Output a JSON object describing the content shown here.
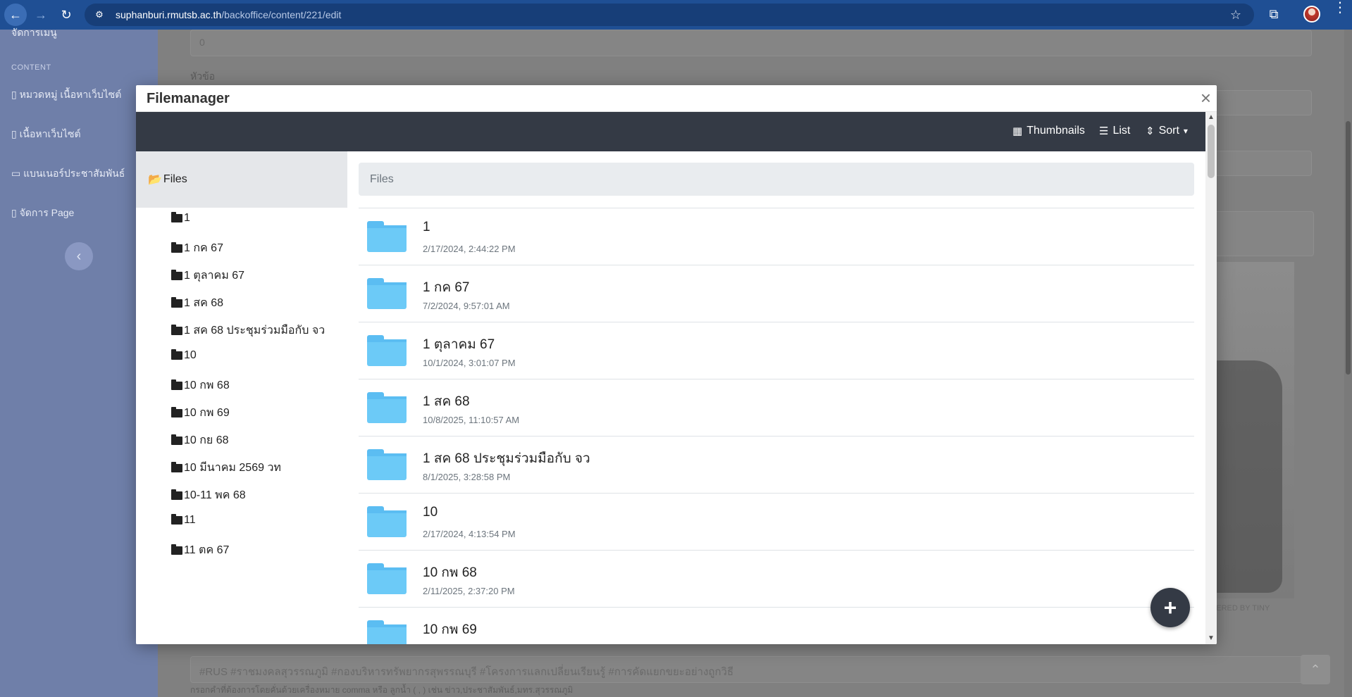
{
  "browser": {
    "url_host": "suphanburi.rmutsb.ac.th",
    "url_path": "/backoffice/content/221/edit",
    "back_icon": "←",
    "forward_icon": "→",
    "reload_icon": "↻",
    "site_icon": "⚙",
    "star_icon": "☆",
    "extensions_icon": "⧉",
    "menu_icon": "⋮"
  },
  "sidebar": {
    "top_item": "จัดการเมนู",
    "section_heading": "CONTENT",
    "items": [
      {
        "label": "หมวดหมู่ เนื้อหาเว็บไซต์"
      },
      {
        "label": "เนื้อหาเว็บไซต์"
      },
      {
        "label": "แบนเนอร์ประชาสัมพันธ์"
      },
      {
        "label": "จัดการ Page"
      }
    ],
    "collapse_icon": "‹"
  },
  "background_form": {
    "order_value": "0",
    "title_label": "หัวข้อ",
    "editor_powered": "POWERED BY TINY",
    "tags_value": "#RUS #ราชมงคลสุวรรณภูมิ #กองบริหารทรัพยากรสุพรรณบุรี #โครงการแลกเปลี่ยนเรียนรู้ #การคัดแยกขยะอย่างถูกวิธี",
    "tags_hint": "กรอกคำที่ต้องการโดยคั่นด้วยเครื่องหมาย comma หรือ ลูกน้ำ ( , ) เช่น ข่าว,ประชาสัมพันธ์,มทร.สุวรรณภูมิ",
    "scroll_top_icon": "⌃"
  },
  "modal": {
    "title": "Filemanager",
    "close_icon": "×",
    "toolbar": {
      "thumbnails_label": "Thumbnails",
      "list_label": "List",
      "sort_label": "Sort",
      "thumbnails_icon": "▦",
      "list_icon": "☰",
      "sort_icon": "⇕",
      "caret_icon": "▾"
    },
    "tree": {
      "root_label": "Files",
      "items": [
        {
          "label": "1"
        },
        {
          "label": "1 กค 67"
        },
        {
          "label": "1 ตุลาคม 67"
        },
        {
          "label": "1 สค 68"
        },
        {
          "label": "1 สค 68 ประชุมร่วมมือกับ จว"
        },
        {
          "label": "10"
        },
        {
          "label": "10 กพ 68"
        },
        {
          "label": "10 กพ 69"
        },
        {
          "label": "10 กย 68"
        },
        {
          "label": "10 มีนาคม 2569 วท"
        },
        {
          "label": "10-11 พค 68"
        },
        {
          "label": "11"
        },
        {
          "label": "11 ตค 67"
        }
      ]
    },
    "breadcrumb": "Files",
    "files": [
      {
        "name": "1",
        "date": "2/17/2024, 2:44:22 PM"
      },
      {
        "name": "1 กค 67",
        "date": "7/2/2024, 9:57:01 AM"
      },
      {
        "name": "1 ตุลาคม 67",
        "date": "10/1/2024, 3:01:07 PM"
      },
      {
        "name": "1 สค 68",
        "date": "10/8/2025, 11:10:57 AM"
      },
      {
        "name": "1 สค 68 ประชุมร่วมมือกับ จว",
        "date": "8/1/2025, 3:28:58 PM"
      },
      {
        "name": "10",
        "date": "2/17/2024, 4:13:54 PM"
      },
      {
        "name": "10 กพ 68",
        "date": "2/11/2025, 2:37:20 PM"
      },
      {
        "name": "10 กพ 69",
        "date": ""
      }
    ],
    "fab_icon": "+"
  }
}
